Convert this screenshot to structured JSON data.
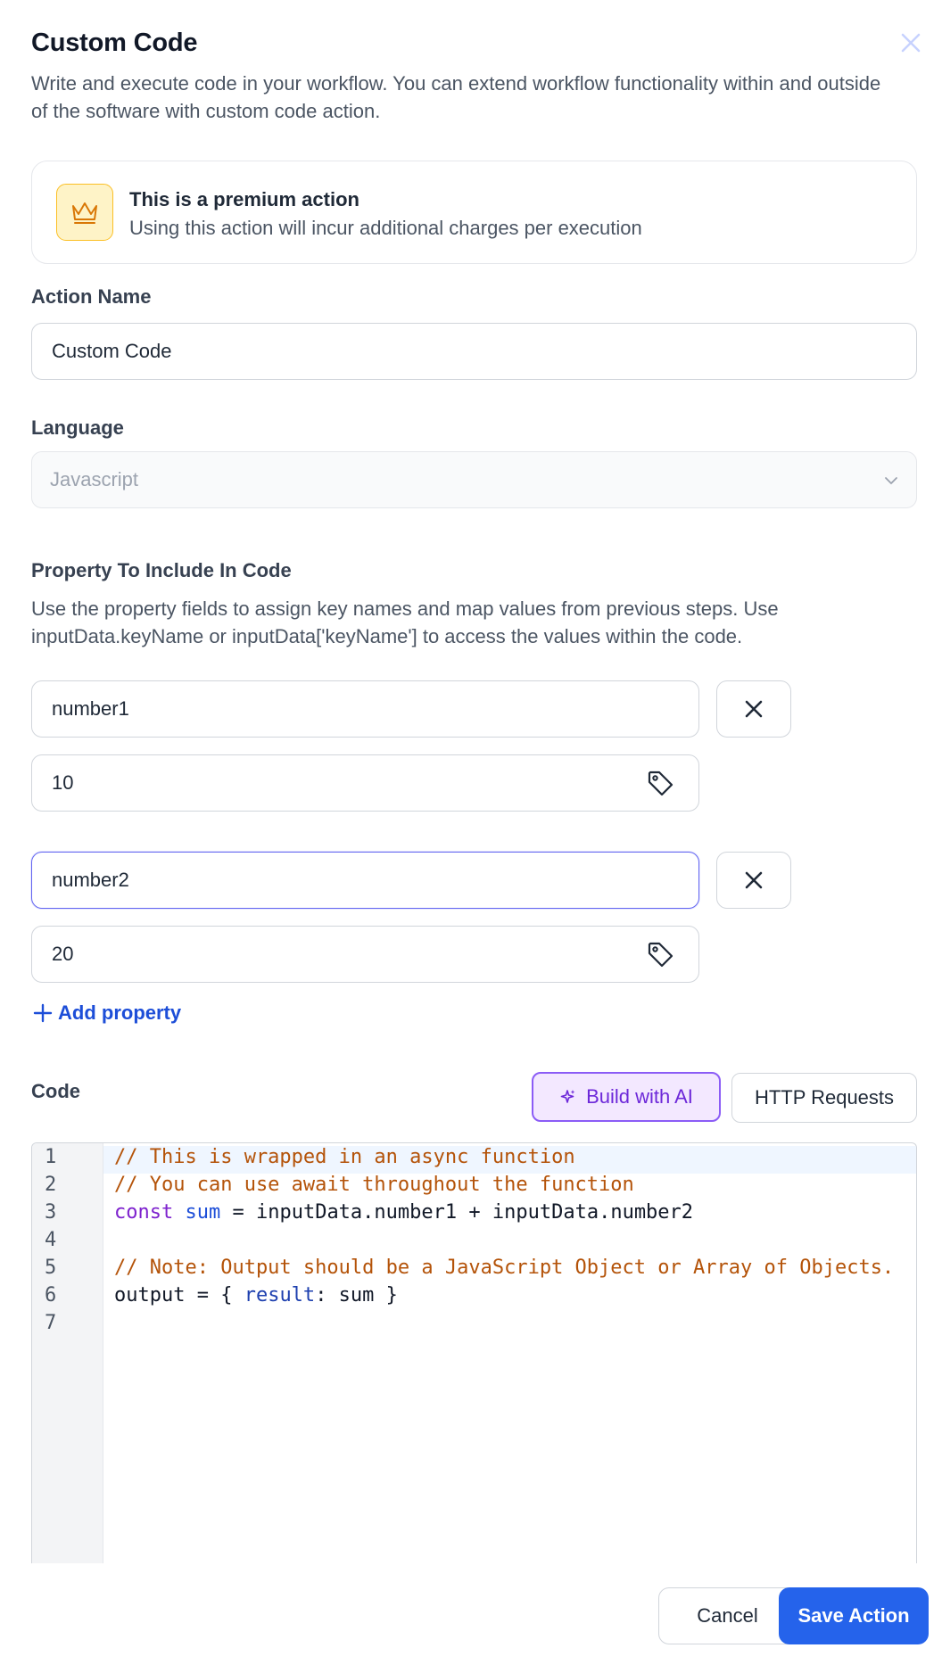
{
  "dialog": {
    "title": "Custom Code",
    "description": "Write and execute code in your workflow. You can extend workflow functionality within and outside of the software with custom code action.",
    "close_icon": "close-icon"
  },
  "premium": {
    "icon": "crown-icon",
    "title": "This is a premium action",
    "subtitle": "Using this action will incur additional charges per execution"
  },
  "action_name": {
    "label": "Action Name",
    "value": "Custom Code"
  },
  "language": {
    "label": "Language",
    "value": "Javascript",
    "icon": "chevron-down-icon"
  },
  "properties": {
    "label": "Property To Include In Code",
    "help": "Use the property fields to assign key names and map values from previous steps. Use inputData.keyName or inputData['keyName'] to access the values within the code.",
    "items": [
      {
        "key": "number1",
        "value": "10"
      },
      {
        "key": "number2",
        "value": "20"
      }
    ],
    "add_label": "Add property"
  },
  "code": {
    "label": "Code",
    "build_ai_label": "Build with AI",
    "http_label": "HTTP Requests",
    "line_numbers": [
      "1",
      "2",
      "3",
      "4",
      "5",
      "6",
      "7"
    ],
    "lines": [
      "// This is wrapped in an async function",
      "// You can use await throughout the function",
      "const sum = inputData.number1 + inputData.number2",
      "",
      "// Note: Output should be a JavaScript Object or Array of Objects.",
      "output = { result: sum }",
      ""
    ]
  },
  "footer": {
    "cancel_label": "Cancel",
    "save_label": "Save Action"
  },
  "colors": {
    "primary": "#2563eb",
    "ai_accent": "#8b5cf6",
    "premium_bg": "#fef3c7"
  }
}
